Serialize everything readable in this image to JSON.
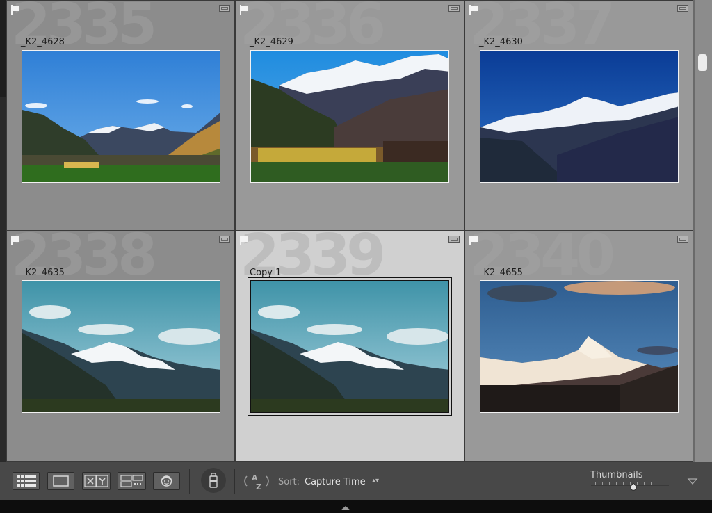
{
  "grid": {
    "cells": [
      {
        "index": "2335",
        "filename": "_K2_4628",
        "scene": "valley-sheep-blue-sky",
        "state": "dark"
      },
      {
        "index": "2336",
        "filename": "_K2_4629",
        "scene": "valley-golden-trees",
        "state": "mid"
      },
      {
        "index": "2337",
        "filename": "_K2_4630",
        "scene": "snowy-ridge-deep-blue",
        "state": "mid"
      },
      {
        "index": "2338",
        "filename": "_K2_4635",
        "scene": "teal-sky-snow-peaks",
        "state": "dark"
      },
      {
        "index": "2339",
        "filename": "Copy 1",
        "scene": "teal-sky-snow-peaks",
        "state": "selected"
      },
      {
        "index": "2340",
        "filename": "_K2_4655",
        "scene": "lit-peak-dusk",
        "state": "mid"
      }
    ]
  },
  "toolbar": {
    "buttons": [
      {
        "name": "grid-view-icon"
      },
      {
        "name": "loupe-view-icon"
      },
      {
        "name": "compare-view-icon",
        "label": "X Y"
      },
      {
        "name": "survey-view-icon"
      },
      {
        "name": "people-view-icon"
      }
    ],
    "painter_icon": "spray-can-icon",
    "sort_direction_icon": "az-sort-icon",
    "sort_label": "Sort:",
    "sort_value": "Capture Time",
    "thumbnails_label": "Thumbnails",
    "thumbnail_size": 0.55,
    "menu_icon": "triangle-down-icon"
  },
  "colors": {
    "grid_dark": "#8c8c8c",
    "grid_mid": "#999999",
    "grid_selected": "#d0d0d0",
    "toolbar_bg": "#484848"
  }
}
